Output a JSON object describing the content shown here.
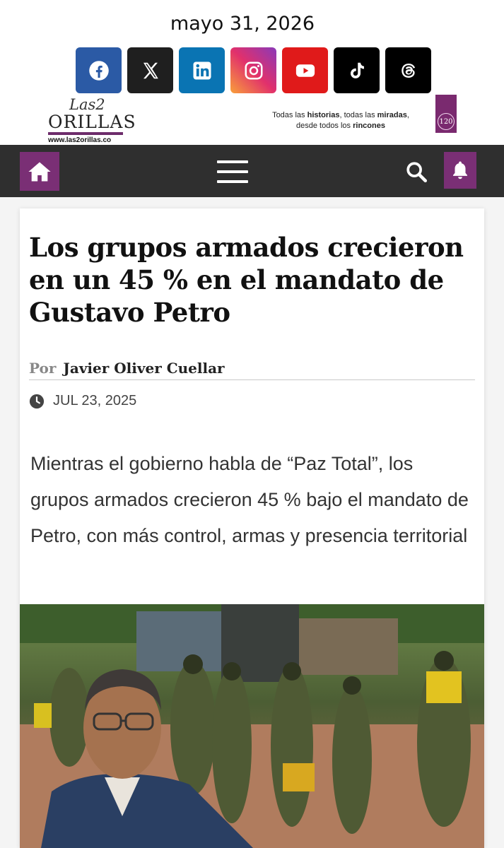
{
  "header": {
    "date": "mayo 31, 2026",
    "socials": [
      {
        "name": "facebook-icon",
        "color": "#2b5aa5"
      },
      {
        "name": "x-icon",
        "color": "#1f1f1f"
      },
      {
        "name": "linkedin-icon",
        "color": "#0a74b3"
      },
      {
        "name": "instagram-icon",
        "color": "#e1306c"
      },
      {
        "name": "youtube-icon",
        "color": "#e01a1a"
      },
      {
        "name": "tiktok-icon",
        "color": "#000000"
      },
      {
        "name": "threads-icon",
        "color": "#000000"
      }
    ],
    "logo": {
      "small": "Las2",
      "big": "ORILLAS",
      "url": "www.las2orillas.co"
    },
    "tagline": {
      "p1": "Todas las ",
      "b1": "historias",
      "p2": ", todas las ",
      "b2": "miradas",
      "p3": ",",
      "p4": "desde todos los ",
      "b3": "rincones"
    },
    "emblem_text": "120"
  },
  "nav": {
    "home_icon": "home-icon",
    "menu_icon": "hamburger-menu-icon",
    "search_icon": "search-icon",
    "bell_icon": "bell-icon",
    "accent": "#7a2f75",
    "bar_color": "#2f2f2f"
  },
  "article": {
    "headline": "Los grupos armados crecieron en un 45 % en el mandato de Gustavo Petro",
    "by_label": "Por",
    "author": "Javier Oliver Cuellar",
    "date": "JUL 23, 2025",
    "lead": "Mientras el gobierno habla de “Paz Total”, los grupos armados crecieron 45 % bajo el mandato de Petro, con más control, armas y presencia territorial"
  }
}
